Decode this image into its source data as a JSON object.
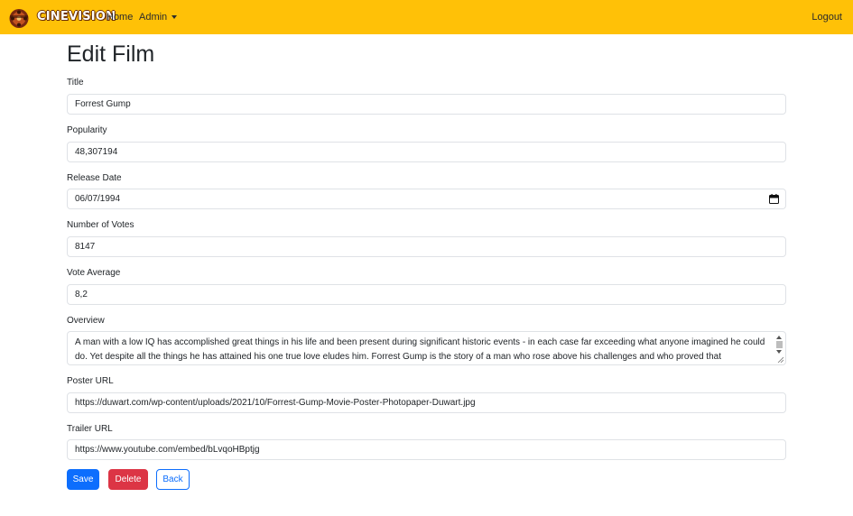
{
  "navbar": {
    "brand": "CINEVISION",
    "logo_icon": "film-reel-mascot-icon",
    "links": {
      "home": "Home",
      "admin": "Admin",
      "logout": "Logout"
    },
    "background": "#ffc107"
  },
  "page": {
    "title": "Edit Film"
  },
  "form": {
    "title": {
      "label": "Title",
      "value": "Forrest Gump"
    },
    "popularity": {
      "label": "Popularity",
      "value": "48,307194"
    },
    "release_date": {
      "label": "Release Date",
      "value": "06/07/1994",
      "icon": "calendar-icon"
    },
    "votes": {
      "label": "Number of Votes",
      "value": "8147"
    },
    "vote_average": {
      "label": "Vote Average",
      "value": "8,2"
    },
    "overview": {
      "label": "Overview",
      "value": "A man with a low IQ has accomplished great things in his life and been present during significant historic events - in each case far exceeding what anyone imagined he could do. Yet despite all the things he has attained his one true love eludes him. Forrest Gump is the story of a man who rose above his challenges and who proved that determination"
    },
    "poster_url": {
      "label": "Poster URL",
      "value": "https://duwart.com/wp-content/uploads/2021/10/Forrest-Gump-Movie-Poster-Photopaper-Duwart.jpg"
    },
    "trailer_url": {
      "label": "Trailer URL",
      "value": "https://www.youtube.com/embed/bLvqoHBptjg"
    }
  },
  "buttons": {
    "save": "Save",
    "delete": "Delete",
    "back": "Back"
  },
  "colors": {
    "primary": "#0d6efd",
    "danger": "#dc3545",
    "warning": "#ffc107"
  }
}
